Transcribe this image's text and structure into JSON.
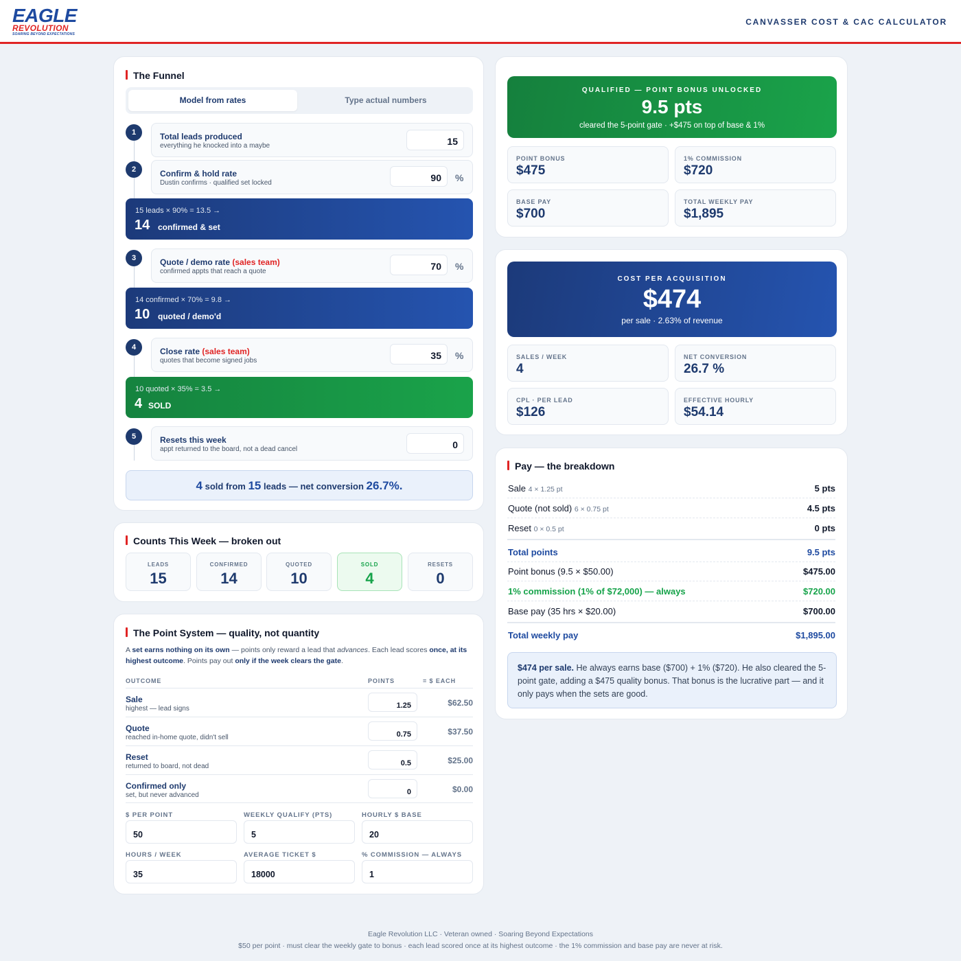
{
  "header": {
    "logo_line1": "EAGLE",
    "logo_line2": "REVOLUTION",
    "logo_line3": "SOARING BEYOND EXPECTATIONS",
    "app_title": "CANVASSER COST & CAC CALCULATOR"
  },
  "funnel": {
    "title": "The Funnel",
    "tabs": [
      "Model from rates",
      "Type actual numbers"
    ],
    "active_tab": "Model from rates",
    "steps": [
      {
        "num": "1",
        "label": "Total leads produced",
        "label_tag": "",
        "sub": "everything he knocked into a maybe",
        "value": "15",
        "unit": ""
      },
      {
        "num": "2",
        "label": "Confirm & hold rate",
        "label_tag": "",
        "sub": "Dustin confirms · qualified set locked",
        "value": "90",
        "unit": "%"
      },
      {
        "num": "3",
        "label": "Quote / demo rate ",
        "label_tag": "(sales team)",
        "sub": "confirmed appts that reach a quote",
        "value": "70",
        "unit": "%"
      },
      {
        "num": "4",
        "label": "Close rate ",
        "label_tag": "(sales team)",
        "sub": "quotes that become signed jobs",
        "value": "35",
        "unit": "%"
      },
      {
        "num": "5",
        "label": "Resets this week",
        "label_tag": "",
        "sub": "appt returned to the board, not a dead cancel",
        "value": "0",
        "unit": ""
      }
    ],
    "results": [
      {
        "equation": "15  leads × 90% = 13.5  →",
        "big": "14",
        "word": "confirmed & set"
      },
      {
        "equation": "14  confirmed × 70% = 9.8 →",
        "big": "10",
        "word": "quoted / demo'd"
      },
      {
        "equation": "10  quoted × 35% = 3.5 →",
        "big": "4",
        "word": "SOLD"
      }
    ],
    "summary": {
      "sold": "4",
      "t1": " sold from ",
      "leads": "15",
      "t2": " leads — net conversion ",
      "conv": "26.7%."
    }
  },
  "counts": {
    "title": "Counts This Week — broken out",
    "tiles": [
      {
        "label": "LEADS",
        "value": "15"
      },
      {
        "label": "CONFIRMED",
        "value": "14"
      },
      {
        "label": "QUOTED",
        "value": "10"
      },
      {
        "label": "SOLD",
        "value": "4"
      },
      {
        "label": "RESETS",
        "value": "0"
      }
    ]
  },
  "points": {
    "title": "The Point System — quality, not quantity",
    "intro": {
      "a": "A ",
      "b1": "set earns nothing on its own",
      "c": " — points only reward a lead that ",
      "i": "advances",
      "d": ". Each lead scores ",
      "b2": "once, at its highest outcome",
      "e": ". Points pay out ",
      "b3": "only if the week clears the gate",
      "f": "."
    },
    "columns": [
      "OUTCOME",
      "POINTS",
      "= $ EACH"
    ],
    "rows": [
      {
        "label": "Sale",
        "sub": "highest — lead signs",
        "points": "1.25",
        "each": "$62.50"
      },
      {
        "label": "Quote",
        "sub": "reached in-home quote, didn't sell",
        "points": "0.75",
        "each": "$37.50"
      },
      {
        "label": "Reset",
        "sub": "returned to board, not dead",
        "points": "0.5",
        "each": "$25.00"
      },
      {
        "label": "Confirmed only",
        "sub": "set, but never advanced",
        "points": "0",
        "each": "$0.00"
      }
    ],
    "fields": [
      {
        "label": "$ PER POINT",
        "value": "50"
      },
      {
        "label": "WEEKLY QUALIFY (PTS)",
        "value": "5"
      },
      {
        "label": "HOURLY $ BASE",
        "value": "20"
      },
      {
        "label": "HOURS / WEEK",
        "value": "35"
      },
      {
        "label": "AVERAGE TICKET $",
        "value": "18000"
      },
      {
        "label": "% COMMISSION — ALWAYS",
        "value": "1"
      }
    ]
  },
  "qualified": {
    "kicker": "QUALIFIED — POINT BONUS UNLOCKED",
    "value": "9.5 pts",
    "caption": "cleared the 5-point gate · +$475 on top of base & 1%",
    "tiles": [
      {
        "label": "POINT BONUS",
        "value": "$475"
      },
      {
        "label": "1% COMMISSION",
        "value": "$720"
      },
      {
        "label": "BASE PAY",
        "value": "$700"
      },
      {
        "label": "TOTAL WEEKLY PAY",
        "value": "$1,895"
      }
    ]
  },
  "cpa": {
    "kicker": "COST PER ACQUISITION",
    "value": "$474",
    "caption": "per sale · 2.63% of revenue",
    "tiles": [
      {
        "label": "SALES / WEEK",
        "value": "4"
      },
      {
        "label": "NET CONVERSION",
        "value": "26.7 %"
      },
      {
        "label": "CPL · PER LEAD",
        "value": "$126"
      },
      {
        "label": "EFFECTIVE HOURLY",
        "value": "$54.14"
      }
    ]
  },
  "breakdown": {
    "title": "Pay — the breakdown",
    "rows": [
      {
        "label": "Sale ",
        "small": "4 × 1.25 pt",
        "value": "5 pts"
      },
      {
        "label": "Quote (not sold) ",
        "small": "6 × 0.75 pt",
        "value": "4.5 pts"
      },
      {
        "label": "Reset ",
        "small": "0 × 0.5 pt",
        "value": "0 pts"
      }
    ],
    "total_points": {
      "label": "Total points",
      "value": "9.5 pts"
    },
    "bonus": {
      "label": "Point bonus (9.5 × $50.00)",
      "value": "$475.00"
    },
    "commission": {
      "label": "1% commission (1% of $72,000) — always",
      "value": "$720.00"
    },
    "base": {
      "label": "Base pay (35 hrs × $20.00)",
      "value": "$700.00"
    },
    "total": {
      "label": "Total weekly pay",
      "value": "$1,895.00"
    },
    "note": {
      "bold": "$474 per sale.",
      "text": " He always earns base ($700) + 1% ($720). He also cleared the 5-point gate, adding a $475 quality bonus. That bonus is the lucrative part — and it only pays when the sets are good."
    }
  },
  "footer": {
    "line1": "Eagle Revolution LLC · Veteran owned · Soaring Beyond Expectations",
    "line2": "$50 per point · must clear the weekly gate to bonus · each lead scored once at its highest outcome · the 1% commission and base pay are never at risk."
  },
  "colors": {
    "brand_blue": "#1e3a6e",
    "accent_red": "#e02424",
    "success_green": "#16a34a"
  }
}
